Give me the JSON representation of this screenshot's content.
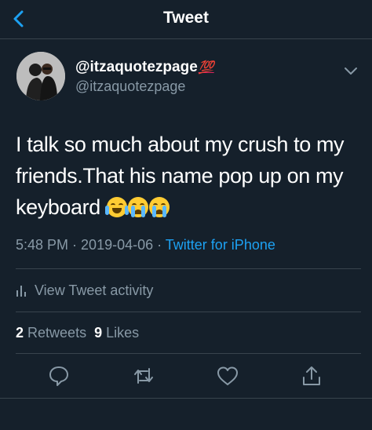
{
  "header": {
    "title": "Tweet",
    "back_icon": "chevron-left-icon"
  },
  "author": {
    "display_name": "@itzaquotezpage",
    "badge": "💯",
    "handle": "@itzaquotezpage"
  },
  "tweet": {
    "text": "I talk so much about my crush to my friends.That his name pop up on my keyboard ",
    "emojis": [
      "face-with-tears-of-joy",
      "loudly-crying-face",
      "loudly-crying-face"
    ]
  },
  "meta": {
    "time": "5:48 PM",
    "sep1": " · ",
    "date": "2019-04-06",
    "sep2": " · ",
    "source": "Twitter for iPhone"
  },
  "activity": {
    "label": "View Tweet activity"
  },
  "stats": {
    "retweets_count": "2",
    "retweets_label": "Retweets",
    "likes_count": "9",
    "likes_label": "Likes"
  },
  "actions": [
    "reply-icon",
    "retweet-icon",
    "like-icon",
    "share-icon"
  ],
  "colors": {
    "background": "#15202b",
    "accent": "#1da1f2",
    "secondary_text": "#8899a6",
    "divider": "#38444d"
  }
}
